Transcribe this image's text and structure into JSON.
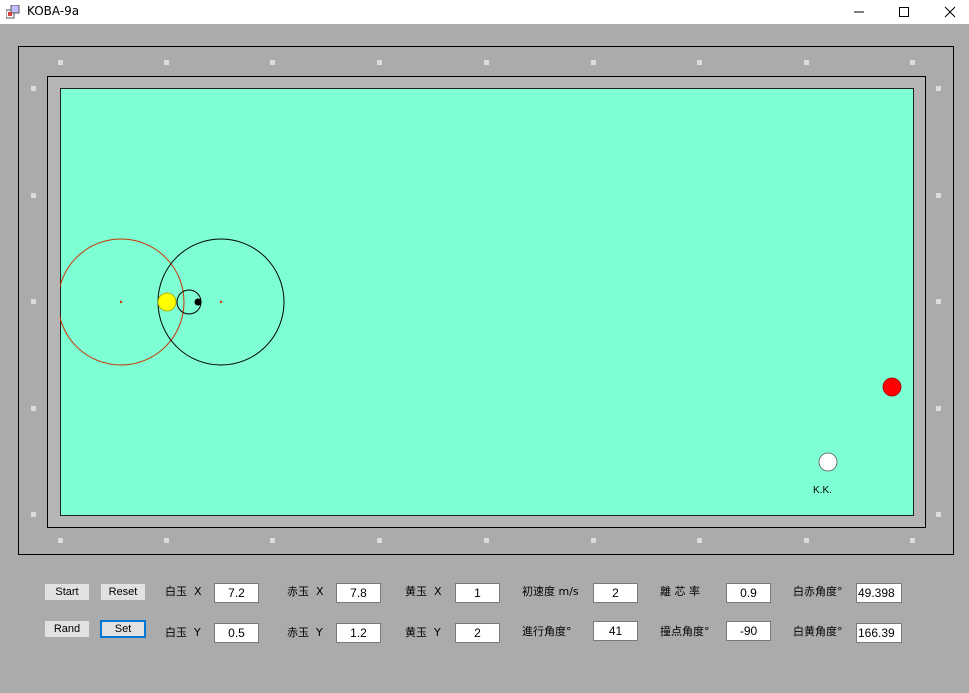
{
  "window": {
    "title": "KOBA-9a",
    "minimize_glyph": "—",
    "maximize_glyph": "☐",
    "close_glyph": "✕"
  },
  "table": {
    "credit": "K.K.",
    "felt_color": "#7fffd4",
    "balls": {
      "white": {
        "color": "#ffffff"
      },
      "red": {
        "color": "#ff0000"
      },
      "yellow": {
        "color": "#ffff00"
      }
    }
  },
  "controls": {
    "start_label": "Start",
    "reset_label": "Reset",
    "rand_label": "Rand",
    "set_label": "Set",
    "white_x_label": "白玉  X",
    "white_x_value": "7.2",
    "white_y_label": "白玉  Y",
    "white_y_value": "0.5",
    "red_x_label": "赤玉  X",
    "red_x_value": "7.8",
    "red_y_label": "赤玉  Y",
    "red_y_value": "1.2",
    "yellow_x_label": "黄玉  X",
    "yellow_x_value": "1",
    "yellow_y_label": "黄玉  Y",
    "yellow_y_value": "2",
    "speed_label": "初速度 m/s",
    "speed_value": "2",
    "direction_label": "進行角度°",
    "direction_value": "41",
    "offset_label": "離 芯 率",
    "offset_value": "0.9",
    "contact_label": "撞点角度°",
    "contact_value": "-90",
    "white_red_angle_label": "白赤角度°",
    "white_red_angle_value": "49.398",
    "white_yellow_angle_label": "白黄角度°",
    "white_yellow_angle_value": "166.39"
  }
}
